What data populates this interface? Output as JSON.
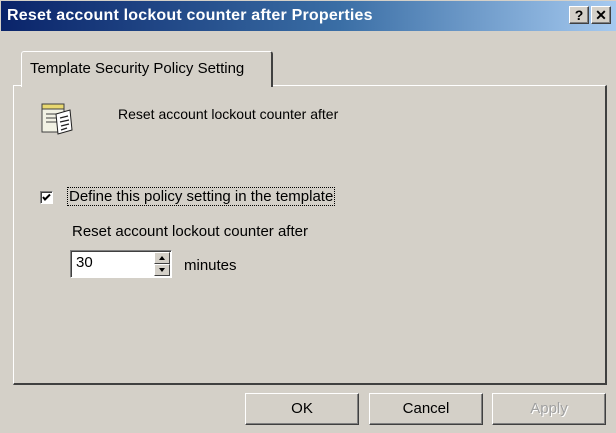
{
  "window": {
    "title": "Reset account lockout counter after Properties",
    "help_glyph": "?",
    "close_glyph": "✕"
  },
  "tabs": [
    {
      "label": "Template Security Policy Setting",
      "selected": true
    }
  ],
  "policy": {
    "icon": "policy-document-icon",
    "title": "Reset account lockout counter after"
  },
  "define_setting": {
    "label": "Define this policy setting in the template",
    "checked": true
  },
  "counter": {
    "label": "Reset account lockout counter after",
    "value": "30",
    "units": "minutes"
  },
  "buttons": {
    "ok": "OK",
    "cancel": "Cancel",
    "apply": "Apply",
    "apply_enabled": false
  }
}
